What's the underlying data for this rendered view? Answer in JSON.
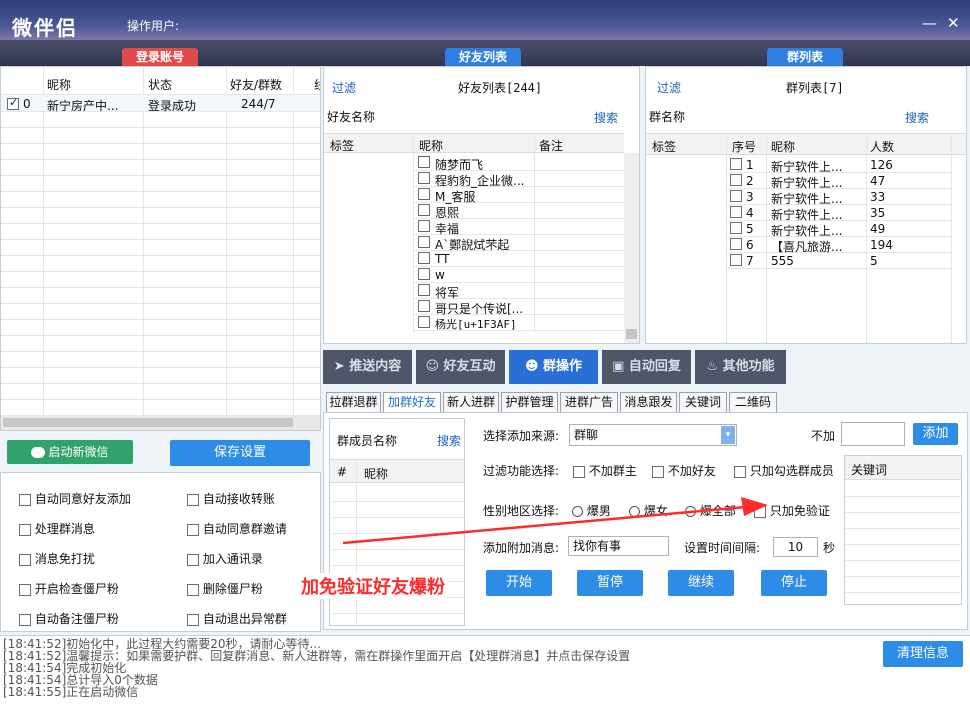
{
  "app": {
    "title": "微伴侣",
    "operator_label": "操作用户:",
    "minimize": "—",
    "close": "✕"
  },
  "tabs": {
    "login": "登录账号",
    "friends": "好友列表",
    "groups": "群列表"
  },
  "accounts": {
    "columns": [
      "昵称",
      "状态",
      "好友/群数",
      "线"
    ],
    "rows": [
      {
        "index": "0",
        "nickname": "新宁房产中...",
        "status": "登录成功",
        "count": "244/7"
      }
    ]
  },
  "friends": {
    "filter_label": "过滤",
    "title": "好友列表[244]",
    "name_label": "好友名称",
    "search": "搜索",
    "col_tag": "标签",
    "col_nick": "昵称",
    "col_note": "备注",
    "items": [
      "随梦而飞",
      "程豹豹_企业微...",
      "M_客服",
      "恩熙",
      "幸福",
      "A`鄭誽烒芣起",
      "TT",
      "w",
      "将军",
      "哥只是个传说[...",
      "杨光[u+1F3AF]"
    ]
  },
  "groups": {
    "filter_label": "过滤",
    "title": "群列表[7]",
    "name_label": "群名称",
    "search": "搜索",
    "col_tag": "标签",
    "col_no": "序号",
    "col_nick": "昵称",
    "col_count": "人数",
    "items": [
      {
        "no": "1",
        "name": "新宁软件上...",
        "count": "126"
      },
      {
        "no": "2",
        "name": "新宁软件上...",
        "count": "47"
      },
      {
        "no": "3",
        "name": "新宁软件上...",
        "count": "33"
      },
      {
        "no": "4",
        "name": "新宁软件上...",
        "count": "35"
      },
      {
        "no": "5",
        "name": "新宁软件上...",
        "count": "49"
      },
      {
        "no": "6",
        "name": "【喜凡旅游...",
        "count": "194"
      },
      {
        "no": "7",
        "name": "555",
        "count": "5"
      }
    ]
  },
  "buttons": {
    "start_wechat": "启动新微信",
    "save_settings": "保存设置",
    "clear_info": "清理信息"
  },
  "options": {
    "left": [
      "自动同意好友添加",
      "处理群消息",
      "消息免打扰",
      "开启检查僵尸粉",
      "自动备注僵尸粉"
    ],
    "right": [
      "自动接收转账",
      "自动同意群邀请",
      "加入通讯录",
      "删除僵尸粉",
      "自动退出异常群"
    ]
  },
  "functions": [
    "推送内容",
    "好友互动",
    "群操作",
    "自动回复",
    "其他功能"
  ],
  "subtabs": [
    "拉群退群",
    "加群好友",
    "新人进群",
    "护群管理",
    "进群广告",
    "消息跟发",
    "关键词",
    "二维码"
  ],
  "addfriend": {
    "member_label": "群成员名称",
    "search": "搜索",
    "col_hash": "#",
    "col_nick": "昵称",
    "source_label": "选择添加来源:",
    "source_value": "群聊",
    "not_add": "不加",
    "add_btn": "添加",
    "filter_label": "过滤功能选择:",
    "filters": [
      "不加群主",
      "不加好友",
      "只加勾选群成员"
    ],
    "gender_label": "性别地区选择:",
    "genders": [
      "爆男",
      "爆女",
      "爆全部"
    ],
    "only_free": "只加免验证",
    "attach_label": "添加附加消息:",
    "attach_value": "找你有事",
    "interval_label": "设置时间间隔:",
    "interval_value": "10",
    "interval_unit": "秒",
    "keyword_col": "关键词",
    "actions": [
      "开始",
      "暂停",
      "继续",
      "停止"
    ]
  },
  "annotation": "加免验证好友爆粉",
  "logs": [
    "[18:41:52]初始化中，此过程大约需要20秒，请耐心等待...",
    "[18:41:52]温馨提示：如果需要护群、回复群消息、新人进群等，需在群操作里面开启【处理群消息】并点击保存设置",
    "[18:41:54]完成初始化",
    "[18:41:54]总计导入0个数据",
    "[18:41:55]正在启动微信"
  ],
  "colors": {
    "accent": "#2c8ce6",
    "tab_red": "#e04a4a",
    "tab_blue": "#2f7fe0",
    "func_dark": "#4f5669",
    "annotation": "#ff2a2a"
  }
}
